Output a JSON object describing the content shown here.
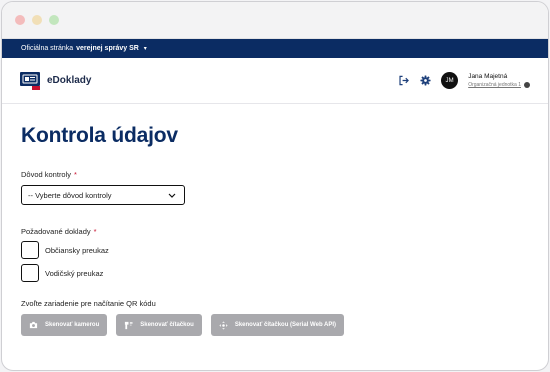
{
  "govbar": {
    "text_prefix": "Oficiálna stránka",
    "text_strong": "verejnej správy SR",
    "caret": "▾"
  },
  "header": {
    "brand_name": "eDoklady",
    "user": {
      "initials": "JM",
      "name": "Jana Majetná",
      "org": "Organizačná jednotka 1"
    },
    "icons": [
      "logout-icon",
      "gear-icon",
      "verified-icon"
    ]
  },
  "page": {
    "title": "Kontrola údajov",
    "reason": {
      "label": "Dôvod kontroly",
      "required_mark": "*",
      "selected": "-- Vyberte dôvod kontroly"
    },
    "documents": {
      "label": "Požadované doklady",
      "required_mark": "*",
      "options": [
        {
          "label": "Občiansky preukaz",
          "checked": false
        },
        {
          "label": "Vodičský preukaz",
          "checked": false
        }
      ]
    },
    "qr": {
      "label": "Zvoľte zariadenie pre načítanie QR kódu",
      "buttons": [
        {
          "label": "Skenovať kamerou",
          "icon": "camera-icon"
        },
        {
          "label": "Skenovať čítačkou",
          "icon": "scanner-icon"
        },
        {
          "label": "Skenovať čítačkou (Serial Web API)",
          "icon": "move-icon"
        }
      ]
    }
  },
  "colors": {
    "gov_blue": "#0b2c63",
    "required": "#c8102e",
    "disabled_button": "#a9a9ad"
  }
}
